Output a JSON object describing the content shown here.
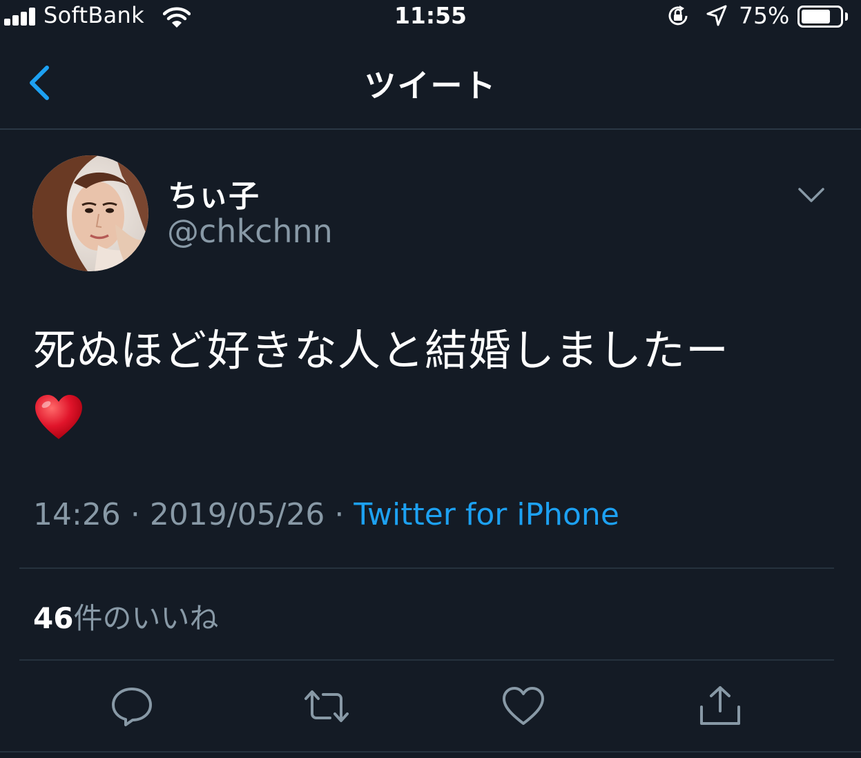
{
  "status_bar": {
    "carrier": "SoftBank",
    "time": "11:55",
    "battery_percent": "75%",
    "battery_level": 0.75,
    "icons": [
      "signal-icon",
      "wifi-icon",
      "rotation-lock-icon",
      "location-icon",
      "battery-icon"
    ]
  },
  "nav": {
    "title": "ツイート",
    "back_icon": "chevron-left-icon"
  },
  "tweet": {
    "display_name": "ちぃ子",
    "handle": "@chkchnn",
    "text": "死ぬほど好きな人と結婚しましたー",
    "emoji": "red-heart",
    "time": "14:26",
    "separator": "·",
    "date": "2019/05/26",
    "source": "Twitter for iPhone",
    "likes_count": "46",
    "likes_label": "件のいいね"
  },
  "actions": {
    "icons": [
      "reply-icon",
      "retweet-icon",
      "like-icon",
      "share-icon"
    ]
  },
  "colors": {
    "background": "#141b25",
    "accent": "#1da1f2",
    "secondary_text": "#8899a6",
    "divider": "#26323e"
  }
}
